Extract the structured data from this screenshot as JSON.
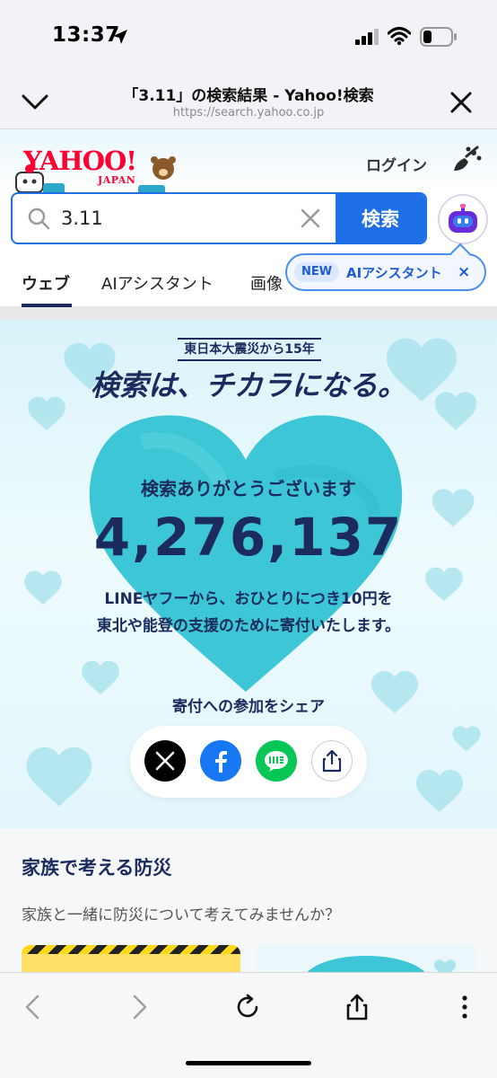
{
  "status_bar": {
    "time": "13:37"
  },
  "browser": {
    "page_title": "「3.11」の検索結果 - Yahoo!検索",
    "url": "https://search.yahoo.co.jp"
  },
  "header": {
    "logo_text": "YAHOO!",
    "logo_sub": "JAPAN",
    "login_label": "ログイン"
  },
  "search": {
    "query": "3.11",
    "button_label": "検索"
  },
  "tabs": [
    {
      "label": "ウェブ",
      "active": true
    },
    {
      "label": "AIアシスタント"
    },
    {
      "label": "画像"
    }
  ],
  "tooltip": {
    "badge": "NEW",
    "label": "AIアシスタント",
    "close": "×"
  },
  "campaign": {
    "subtitle": "東日本大震災から15年",
    "title": "検索は、チカラになる。",
    "thanks": "検索ありがとうございます",
    "count": "4,276,137",
    "donate_line_1": "LINEヤフーから、おひとりにつき10円を",
    "donate_line_2": "東北や能登の支援のために寄付いたします。",
    "share_label": "寄付への参加をシェア",
    "colors": {
      "heart": "#3cc6d6",
      "navy": "#1b2b5e"
    }
  },
  "disaster": {
    "title": "家族で考える防災",
    "description": "家族と一緒に防災について考えてみませんか？"
  }
}
